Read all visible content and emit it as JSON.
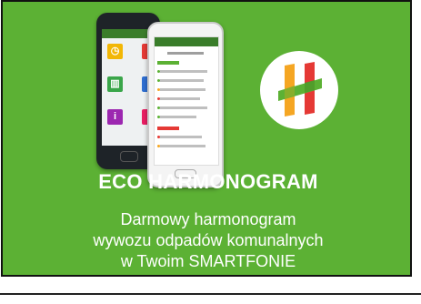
{
  "banner": {
    "title": "ECO HARMONOGRAM",
    "subtitle_lines": [
      "Darmowy harmonogram",
      "wywozu odpadów komunalnych",
      "w Twoim SMARTFONIE"
    ],
    "background_color": "#5cb134",
    "logo_icon": "eco-harmonogram-logo-icon",
    "logo_colors": [
      "#f5a623",
      "#e53935",
      "#5cb134"
    ]
  }
}
